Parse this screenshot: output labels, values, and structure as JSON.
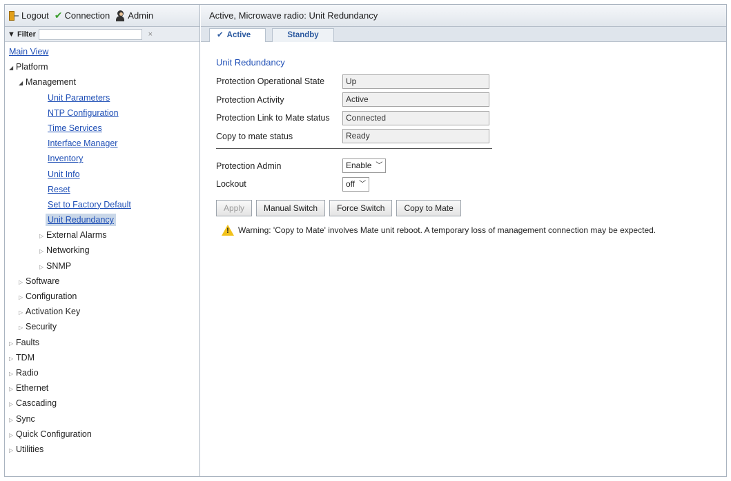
{
  "toolbar": {
    "logout_label": "Logout",
    "connection_label": "Connection",
    "admin_label": "Admin"
  },
  "filter": {
    "label": "Filter",
    "value": "",
    "clear_glyph": "×"
  },
  "tree": {
    "main_view": "Main View",
    "platform": "Platform",
    "management": "Management",
    "management_items": [
      "Unit Parameters",
      "NTP Configuration",
      "Time Services",
      "Interface Manager",
      "Inventory",
      "Unit Info",
      "Reset",
      "Set to Factory Default",
      "Unit Redundancy"
    ],
    "management_groups": [
      "External Alarms",
      "Networking",
      "SNMP"
    ],
    "platform_groups": [
      "Software",
      "Configuration",
      "Activation Key",
      "Security"
    ],
    "root_groups": [
      "Faults",
      "TDM",
      "Radio",
      "Ethernet",
      "Cascading",
      "Sync",
      "Quick Configuration",
      "Utilities"
    ],
    "selected": "Unit Redundancy"
  },
  "header": {
    "title": "Active, Microwave radio: Unit Redundancy"
  },
  "tabs": {
    "active": "Active",
    "standby": "Standby"
  },
  "form": {
    "section_title": "Unit Redundancy",
    "fields": [
      {
        "label": "Protection Operational State",
        "value": "Up"
      },
      {
        "label": "Protection Activity",
        "value": "Active"
      },
      {
        "label": "Protection Link to Mate status",
        "value": "Connected"
      },
      {
        "label": "Copy to mate status",
        "value": "Ready"
      }
    ],
    "protection_admin_label": "Protection Admin",
    "protection_admin_value": "Enable",
    "lockout_label": "Lockout",
    "lockout_value": "off"
  },
  "buttons": {
    "apply": "Apply",
    "manual_switch": "Manual Switch",
    "force_switch": "Force Switch",
    "copy_to_mate": "Copy to Mate"
  },
  "warning": {
    "text": "Warning: 'Copy to Mate' involves Mate unit reboot. A temporary loss of management connection may be expected."
  }
}
